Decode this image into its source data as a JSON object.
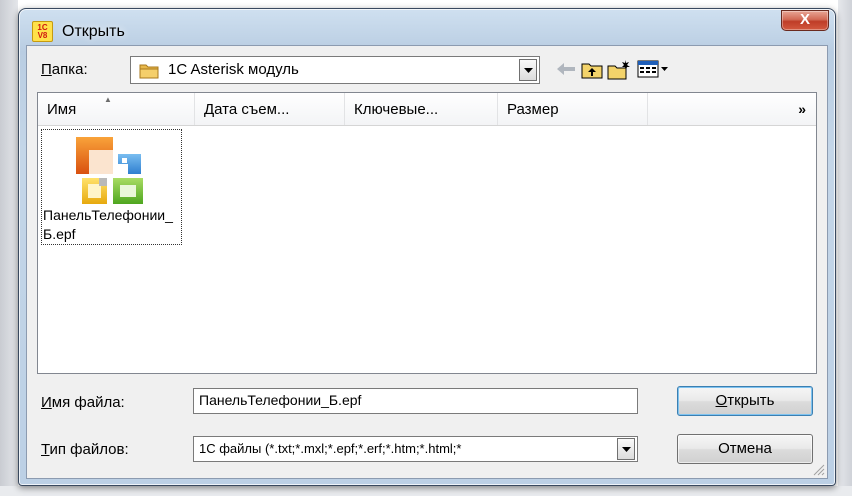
{
  "window": {
    "title": "Открыть",
    "app_icon_top": "1С",
    "app_icon_bottom": "V8",
    "close_glyph": "X"
  },
  "folder": {
    "label_accel": "П",
    "label_rest": "апка:",
    "current": "1C Asterisk модуль",
    "icon": "folder-icon"
  },
  "toolbar": {
    "back_icon": "back-arrow-icon",
    "up_icon": "folder-up-icon",
    "new_folder_icon": "new-folder-icon",
    "view_menu_icon": "view-menu-icon"
  },
  "filelist": {
    "columns": [
      "Имя",
      "Дата съем...",
      "Ключевые...",
      "Размер"
    ],
    "more_glyph": "»",
    "items": [
      {
        "name": "ПанельТелефонии_Б.epf",
        "icon": "office-file-icon"
      }
    ]
  },
  "filename": {
    "label_accel": "И",
    "label_rest": "мя файла:",
    "value": "ПанельТелефонии_Б.epf"
  },
  "filetype": {
    "label_accel": "Т",
    "label_rest": "ип файлов:",
    "selected": "1С файлы (*.txt;*.mxl;*.epf;*.erf;*.htm;*.html;*"
  },
  "buttons": {
    "open_accel": "О",
    "open_rest": "ткрыть",
    "cancel": "Отмена"
  }
}
